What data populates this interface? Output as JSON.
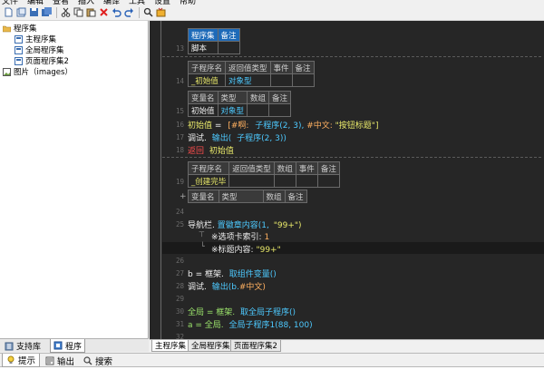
{
  "menu": [
    "文件",
    "编辑",
    "查看",
    "插入",
    "编译",
    "工具",
    "设置",
    "帮助"
  ],
  "tree": {
    "root": "程序集",
    "children": [
      "主程序集",
      "全局程序集",
      "页面程序集2"
    ],
    "images": "图片（images）"
  },
  "left_tabs": [
    "支持库",
    "程序"
  ],
  "editor": {
    "line_numbers": [
      "13",
      "14",
      "15",
      "16",
      "17",
      "18",
      "19",
      "24",
      "25",
      "26",
      "27",
      "28",
      "29",
      "30",
      "31",
      "32"
    ],
    "assembly_table": {
      "headers": [
        "程序集",
        "备注"
      ],
      "value": "脚本"
    },
    "sub1_table": {
      "headers": [
        "子程序名",
        "返回值类型",
        "事件",
        "备注"
      ],
      "name": "_初始值",
      "return_type": "对象型"
    },
    "var_table": {
      "headers": [
        "变量名",
        "类型",
        "数组",
        "备注"
      ],
      "name": "初始值",
      "type": "对象型"
    },
    "line16": {
      "a": "初始值",
      "b": "=",
      "c": "[#啊:",
      "d": "子程序(2, 3),",
      "e": "#中文:",
      "f": "\"按钮标题\"]"
    },
    "line17": {
      "a": "调试.",
      "b": "输出(",
      "c": "子程序(2, 3))"
    },
    "line18": {
      "a": "返回",
      "b": "初始值"
    },
    "sub2_table": {
      "headers": [
        "子程序名",
        "返回值类型",
        "数组",
        "事件",
        "备注"
      ],
      "name": "_创建完毕"
    },
    "var2_table": {
      "headers": [
        "变量名",
        "类型",
        "数组",
        "备注"
      ]
    },
    "line25": {
      "a": "导航栏.",
      "b": "置徽章内容(1,",
      "c": "\"99+\")"
    },
    "line25_sub1": {
      "a": "※选项卡索引:",
      "b": "1"
    },
    "line25_sub2": {
      "a": "※标题内容:",
      "b": "\"99+\""
    },
    "line27": {
      "a": "b = 框架.",
      "b": "取组件变量()"
    },
    "line28": {
      "a": "调试.",
      "b": "输出(b.",
      "c": "#中文)"
    },
    "line30": {
      "a": "全局 = 框架.",
      "b": "取全局子程序()"
    },
    "line31": {
      "a": "a = 全局.",
      "b": "全局子程序1(88, 100)"
    }
  },
  "editor_tabs": [
    "主程序集",
    "全局程序集",
    "页面程序集2"
  ],
  "bottom_tabs": [
    "提示",
    "输出",
    "搜索"
  ]
}
